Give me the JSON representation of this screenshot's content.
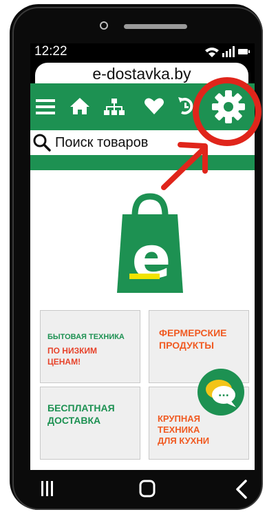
{
  "status_bar": {
    "time": "12:22"
  },
  "site": {
    "url": "e-dostavka.by"
  },
  "nav": {
    "icons": [
      "menu-icon",
      "home-icon",
      "sitemap-icon",
      "heart-icon",
      "history-icon",
      "gear-icon"
    ]
  },
  "search": {
    "placeholder": "Поиск товаров"
  },
  "logo": {
    "letter": "e"
  },
  "tiles": [
    {
      "line1": "БЫТОВАЯ ТЕХНИКА",
      "line2": "ПО НИЗКИМ",
      "line3": "ЦЕНАМ!"
    },
    {
      "line1": "ФЕРМЕРСКИЕ",
      "line2": "ПРОДУКТЫ"
    },
    {
      "line1": "БЕСПЛАТНАЯ",
      "line2": "ДОСТАВКА"
    },
    {
      "line1": "КРУПНАЯ",
      "line2": "ТЕХНИКА",
      "line3": "ДЛЯ КУХНИ"
    }
  ],
  "chat": {
    "icon": "chat-icon",
    "dots": "..."
  },
  "android_nav": {
    "icons": [
      "recents-icon",
      "home-circle-icon",
      "back-icon"
    ]
  },
  "colors": {
    "brand_green": "#1d9152",
    "annotation_red": "#e0251b",
    "tile_orange": "#f05a22",
    "logo_yellow": "#f2e300"
  }
}
